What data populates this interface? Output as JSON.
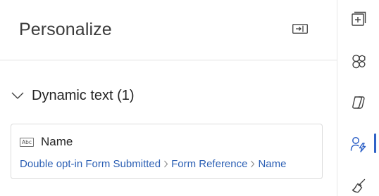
{
  "panel": {
    "title": "Personalize"
  },
  "section": {
    "title": "Dynamic text (1)"
  },
  "card": {
    "icon_text": "Abc",
    "title": "Name",
    "breadcrumb": [
      "Double opt-in Form Submitted",
      "Form Reference",
      "Name"
    ]
  },
  "rail": {
    "items": [
      "add-element-icon",
      "elements-icon",
      "copilot-icon",
      "personalize-icon",
      "styles-icon"
    ],
    "active": "personalize-icon"
  },
  "colors": {
    "accent": "#2f62c7",
    "link": "#2b5fb4",
    "text": "#242424",
    "border": "#dcdcdc"
  }
}
